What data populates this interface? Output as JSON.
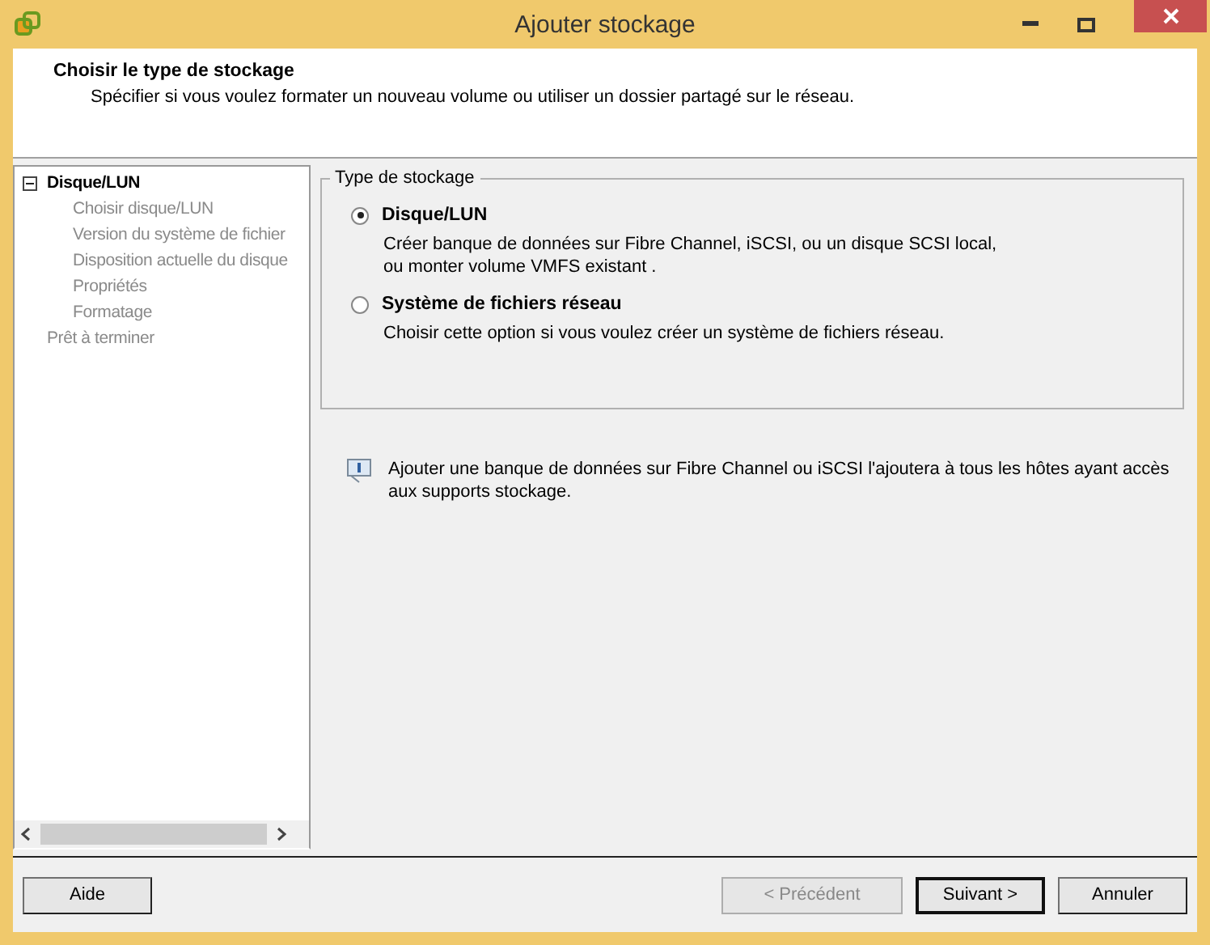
{
  "window": {
    "title": "Ajouter stockage"
  },
  "header": {
    "title": "Choisir le type de stockage",
    "subtitle": "Spécifier si vous voulez formater un nouveau volume ou utiliser un dossier partagé sur le réseau."
  },
  "steps": [
    {
      "label": "Disque/LUN",
      "selected": true,
      "expanded": true,
      "children": [
        {
          "label": "Choisir disque/LUN",
          "selected": false
        },
        {
          "label": "Version du système de fichier",
          "selected": false
        },
        {
          "label": "Disposition actuelle du disque",
          "selected": false
        },
        {
          "label": "Propriétés",
          "selected": false
        },
        {
          "label": "Formatage",
          "selected": false
        }
      ]
    },
    {
      "label": "Prêt à terminer",
      "selected": false
    }
  ],
  "storage_type": {
    "legend": "Type de stockage",
    "options": [
      {
        "label": "Disque/LUN",
        "selected": true,
        "description": "Créer banque de données sur Fibre Channel, iSCSI, ou un disque SCSI local,\nou monter volume VMFS existant ."
      },
      {
        "label": "Système de fichiers réseau",
        "selected": false,
        "description": "Choisir cette option si vous voulez créer un système de fichiers réseau."
      }
    ]
  },
  "info": "Ajouter une banque de données sur Fibre Channel ou iSCSI l'ajoutera à tous les hôtes ayant accès aux supports stockage.",
  "buttons": [
    {
      "label": "Aide",
      "disabled": false,
      "default": false
    },
    {
      "label": "< Précédent",
      "disabled": true,
      "default": false
    },
    {
      "label": "Suivant >",
      "disabled": false,
      "default": true
    },
    {
      "label": "Annuler",
      "disabled": false,
      "default": false
    }
  ]
}
